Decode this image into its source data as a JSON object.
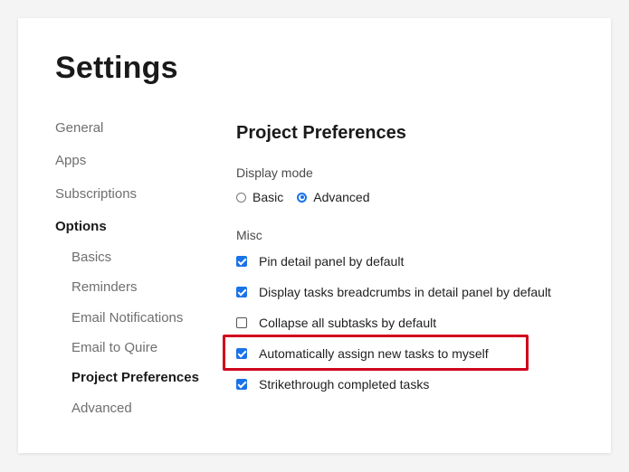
{
  "page": {
    "title": "Settings"
  },
  "nav": {
    "items": [
      {
        "label": "General"
      },
      {
        "label": "Apps"
      },
      {
        "label": "Subscriptions"
      },
      {
        "label": "Options"
      },
      {
        "label": "Basics"
      },
      {
        "label": "Reminders"
      },
      {
        "label": "Email Notifications"
      },
      {
        "label": "Email to Quire"
      },
      {
        "label": "Project Preferences"
      },
      {
        "label": "Advanced"
      }
    ],
    "active_parent": "Options",
    "active_child": "Project Preferences"
  },
  "section": {
    "title": "Project Preferences",
    "display_mode": {
      "label": "Display mode",
      "options": [
        {
          "label": "Basic",
          "selected": false
        },
        {
          "label": "Advanced",
          "selected": true
        }
      ]
    },
    "misc": {
      "label": "Misc",
      "options": [
        {
          "label": "Pin detail panel by default",
          "checked": true
        },
        {
          "label": "Display tasks breadcrumbs in detail panel by default",
          "checked": true
        },
        {
          "label": "Collapse all subtasks by default",
          "checked": false
        },
        {
          "label": "Automatically assign new tasks to myself",
          "checked": true
        },
        {
          "label": "Strikethrough completed tasks",
          "checked": true
        }
      ]
    }
  },
  "colors": {
    "accent": "#1a73e8",
    "highlight": "#d0021b"
  }
}
